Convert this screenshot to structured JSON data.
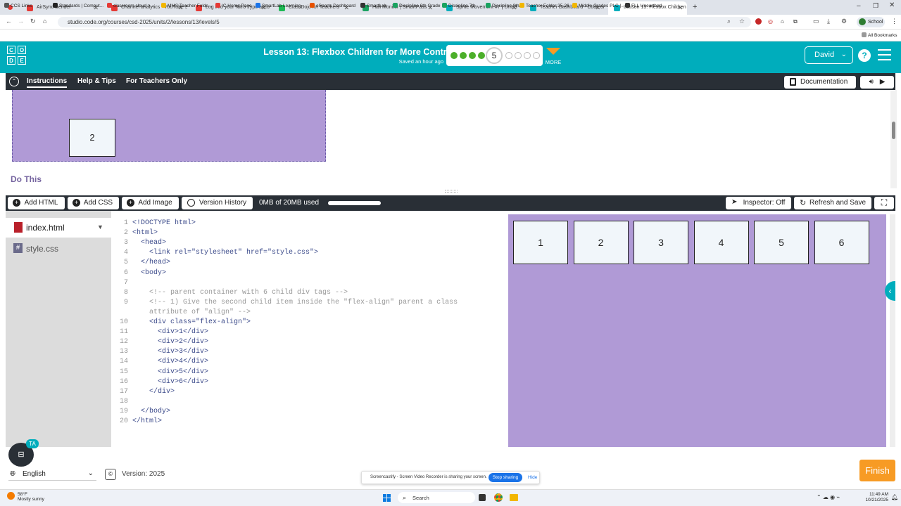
{
  "browser": {
    "tabs": [
      {
        "title": "AirSync Sender",
        "color": "#e53935",
        "active": false
      },
      {
        "title": "Channel analytics - YouTube St...",
        "color": "#e53935",
        "active": false
      },
      {
        "title": "Log into your Nitro Type acco...",
        "color": "#e53935",
        "active": false
      },
      {
        "title": "ClassDojo for Teachers",
        "color": "#1db954",
        "active": false
      },
      {
        "title": "Hall Monitor | SmartPass",
        "color": "#1aa260",
        "active": false
      },
      {
        "title": "Sprite Movement #7 | Unit 3 - ...",
        "color": "#00adbc",
        "active": false
      },
      {
        "title": "Teacher Dashboard - Code.org",
        "color": "#00adbc",
        "active": false
      },
      {
        "title": "Lesson 13: Flexbox Children fo...",
        "color": "#00adbc",
        "active": true
      }
    ],
    "url": "studio.code.org/courses/csd-2025/units/2/lessons/13/levels/5",
    "profile": "School",
    "all_bookmarks": "All Bookmarks",
    "bookmarks": [
      {
        "label": "CCS Links",
        "color": "#555"
      },
      {
        "label": "Standards | Comput...",
        "color": "#222"
      },
      {
        "label": "classroom.cloud >...",
        "color": "#e53935"
      },
      {
        "label": "MMS Teacher Folde...",
        "color": "#f2b600"
      },
      {
        "label": "IC Home Page",
        "color": "#e53935"
      },
      {
        "label": "SmartLab Learning...",
        "color": "#1a73e8"
      },
      {
        "label": "eSports Dashboard",
        "color": "#e65100"
      },
      {
        "label": "SmartLab",
        "color": "#333"
      },
      {
        "label": "Discipline 6th Grade",
        "color": "#1aa260"
      },
      {
        "label": "Discipline 7th",
        "color": "#1aa260"
      },
      {
        "label": "Discipline 8th",
        "color": "#1aa260"
      },
      {
        "label": "Teacher Folder 25-26",
        "color": "#f2b600"
      },
      {
        "label": "Middle Grades PLC |...",
        "color": "#f2b600"
      },
      {
        "label": "FLL Unearthed",
        "color": "#333"
      }
    ]
  },
  "header": {
    "logo_letters": [
      "C",
      "O",
      "D",
      "E"
    ],
    "lesson_title": "Lesson 13: Flexbox Children for More Control",
    "saved_text": "Saved an hour ago",
    "current_level": "5",
    "more_label": "MORE",
    "user_name": "David",
    "help_label": "?",
    "accent_color": "#00adbc"
  },
  "instructions": {
    "tabs": [
      "Instructions",
      "Help & Tips",
      "For Teachers Only"
    ],
    "documentation_label": "Documentation",
    "example_box_label": "2",
    "do_this_label": "Do This"
  },
  "toolbar": {
    "add_html": "Add HTML",
    "add_css": "Add CSS",
    "add_image": "Add Image",
    "version_history": "Version History",
    "storage": "0MB of 20MB used",
    "inspector": "Inspector: Off",
    "refresh_save": "Refresh and Save"
  },
  "files": [
    {
      "name": "index.html",
      "active": true
    },
    {
      "name": "style.css",
      "active": false
    }
  ],
  "code_lines": [
    "<!DOCTYPE html>",
    "<html>",
    "  <head>",
    "    <link rel=\"stylesheet\" href=\"style.css\">",
    "  </head>",
    "  <body>",
    "",
    "    <!-- parent container with 6 child div tags -->",
    "    <!-- 1) Give the second child item inside the \"flex-align\" parent a class",
    "    attribute of \"align\" -->",
    "    <div class=\"flex-align\">",
    "      <div>1</div>",
    "      <div>2</div>",
    "      <div>3</div>",
    "      <div>4</div>",
    "      <div>5</div>",
    "      <div>6</div>",
    "    </div>",
    "",
    "  </body>",
    "</html>"
  ],
  "line_numbers": [
    "1",
    "2",
    "3",
    "4",
    "5",
    "6",
    "7",
    "8",
    "9",
    "",
    "10",
    "11",
    "12",
    "13",
    "14",
    "15",
    "16",
    "17",
    "18",
    "19",
    "20"
  ],
  "preview_boxes": [
    "1",
    "2",
    "3",
    "4",
    "5",
    "6"
  ],
  "footer": {
    "ta_label": "TA",
    "language": "English",
    "copyright_symbol": "©",
    "version": "Version: 2025",
    "finish_label": "Finish",
    "screencastify_text": "Screencastify - Screen Video Recorder is sharing your screen.",
    "stop_sharing": "Stop sharing",
    "hide": "Hide"
  },
  "taskbar": {
    "weather_temp": "58°F",
    "weather_desc": "Mostly sunny",
    "search": "Search",
    "time": "11:49 AM",
    "date": "10/21/2025"
  }
}
